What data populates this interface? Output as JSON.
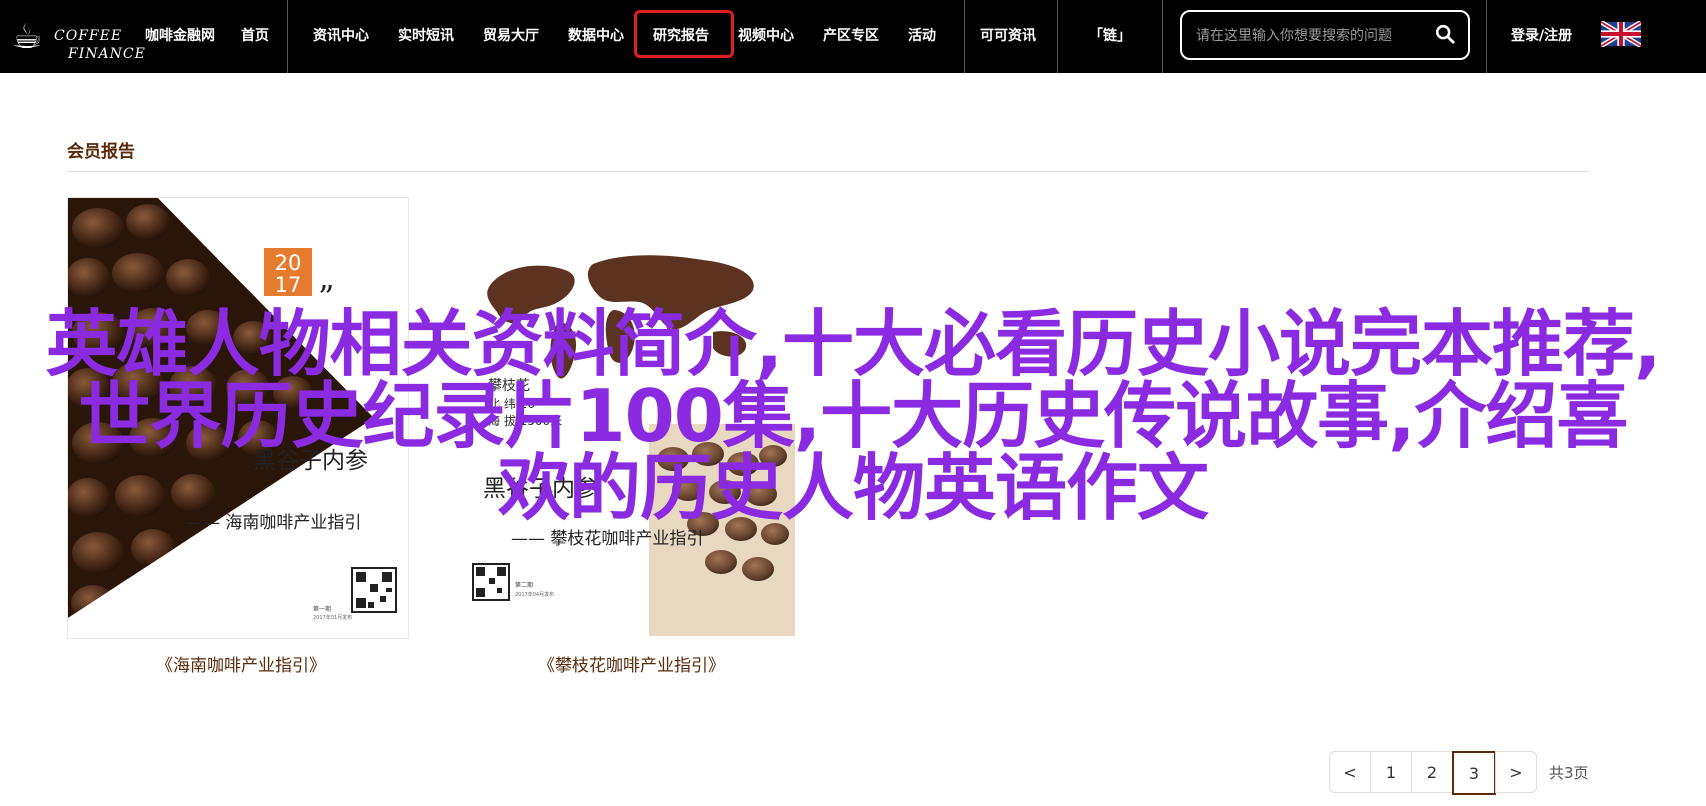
{
  "header": {
    "logo_line1": "COFFEE",
    "logo_line2": "FINANCE",
    "nav": [
      {
        "label": "咖啡金融网",
        "name": "nav-site-name"
      },
      {
        "label": "首页",
        "name": "nav-home"
      },
      {
        "label": "资讯中心",
        "name": "nav-news"
      },
      {
        "label": "实时短讯",
        "name": "nav-flash"
      },
      {
        "label": "贸易大厅",
        "name": "nav-trade"
      },
      {
        "label": "数据中心",
        "name": "nav-data"
      },
      {
        "label": "研究报告",
        "name": "nav-research"
      },
      {
        "label": "视频中心",
        "name": "nav-video"
      },
      {
        "label": "产区专区",
        "name": "nav-region"
      },
      {
        "label": "活动",
        "name": "nav-events"
      },
      {
        "label": "可可资讯",
        "name": "nav-cocoa"
      },
      {
        "label": "「链」",
        "name": "nav-chain"
      }
    ],
    "active_nav": "研究报告",
    "search_placeholder": "请在这里输入你想要搜索的问题",
    "login": "登录/注册",
    "language_flag": "uk-flag-icon"
  },
  "section": {
    "title": "会员报告"
  },
  "reports": [
    {
      "caption": "《海南咖啡产业指引》",
      "cover_year_top": "20",
      "cover_year_bottom": "17",
      "cover_quote": "”",
      "cover_title": "黑谷子内参",
      "cover_subtitle": "—— 海南咖啡产业指引",
      "cover_issue": "第一期",
      "cover_date": "2017年01月发布"
    },
    {
      "caption": "《攀枝花咖啡产业指引》",
      "cover_place": "攀枝花",
      "cover_lat": "北 纬  26°",
      "cover_alt": "海 拔  1500米",
      "cover_title": "黑谷子内参",
      "cover_subtitle": "—— 攀枝花咖啡产业指引",
      "cover_issue": "第二期",
      "cover_date": "2017年04月发布"
    }
  ],
  "overlay_text": {
    "line1": "英雄人物相关资料简介,十大必看历史小说完本推荐,",
    "line2": "世界历史纪录片100集,十大历史传说故事,介绍喜",
    "line3": "欢的历史人物英语作文"
  },
  "pagination": {
    "prev": "<",
    "pages": [
      "1",
      "2",
      "3"
    ],
    "current": "3",
    "next": ">",
    "total": "共3页"
  },
  "colors": {
    "header_bg": "#000000",
    "active_highlight": "#e02020",
    "section_title": "#5a2a0a",
    "overlay": "#8a2be2"
  }
}
